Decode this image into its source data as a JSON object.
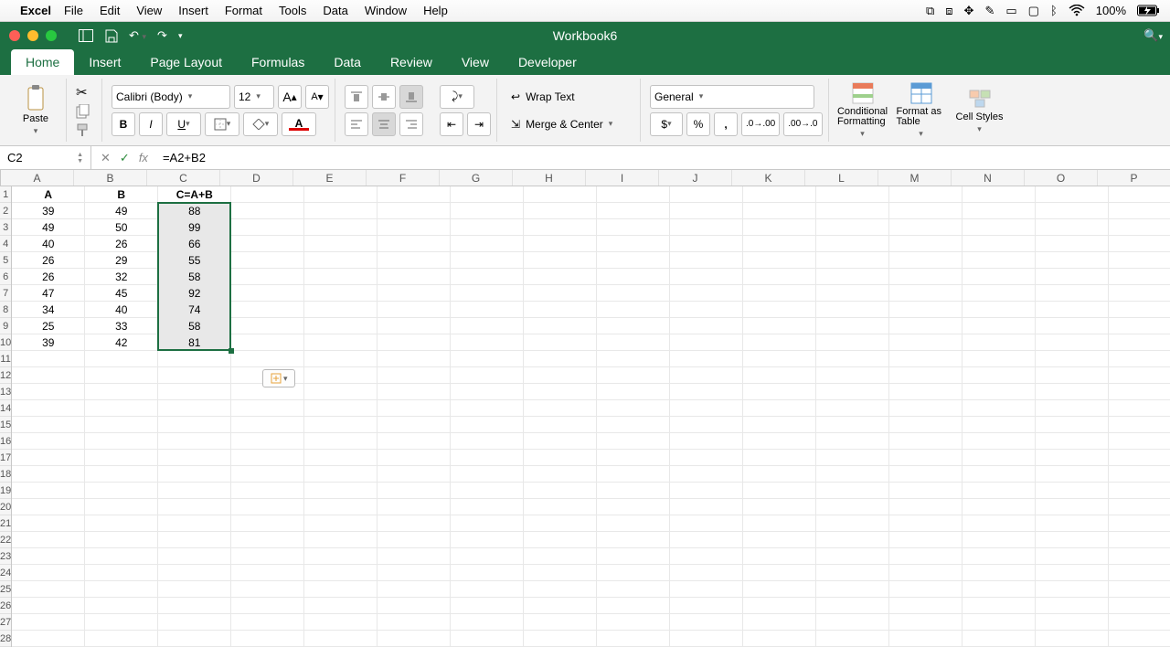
{
  "menubar": {
    "app": "Excel",
    "items": [
      "File",
      "Edit",
      "View",
      "Insert",
      "Format",
      "Tools",
      "Data",
      "Window",
      "Help"
    ],
    "battery": "100%"
  },
  "titlebar": {
    "title": "Workbook6"
  },
  "tabs": [
    "Home",
    "Insert",
    "Page Layout",
    "Formulas",
    "Data",
    "Review",
    "View",
    "Developer"
  ],
  "active_tab": "Home",
  "ribbon": {
    "paste": "Paste",
    "font_name": "Calibri (Body)",
    "font_size": "12",
    "bold": "B",
    "italic": "I",
    "underline": "U",
    "wrap": "Wrap Text",
    "merge": "Merge & Center",
    "number_format": "General",
    "currency": "$",
    "percent": "%",
    "comma": ",",
    "cond_fmt": "Conditional Formatting",
    "as_table": "Format as Table",
    "cell_styles": "Cell Styles",
    "font_grow": "A",
    "font_shrink": "A"
  },
  "formula_bar": {
    "cell_ref": "C2",
    "formula": "=A2+B2",
    "fx": "fx"
  },
  "chart_data": {
    "type": "table",
    "columns": [
      "A",
      "B",
      "C=A+B"
    ],
    "rows": [
      [
        39,
        49,
        88
      ],
      [
        49,
        50,
        99
      ],
      [
        40,
        26,
        66
      ],
      [
        26,
        29,
        55
      ],
      [
        26,
        32,
        58
      ],
      [
        47,
        45,
        92
      ],
      [
        34,
        40,
        74
      ],
      [
        25,
        33,
        58
      ],
      [
        39,
        42,
        81
      ]
    ]
  },
  "grid": {
    "col_letters": [
      "A",
      "B",
      "C",
      "D",
      "E",
      "F",
      "G",
      "H",
      "I",
      "J",
      "K",
      "L",
      "M",
      "N",
      "O",
      "P"
    ],
    "total_rows": 28
  }
}
